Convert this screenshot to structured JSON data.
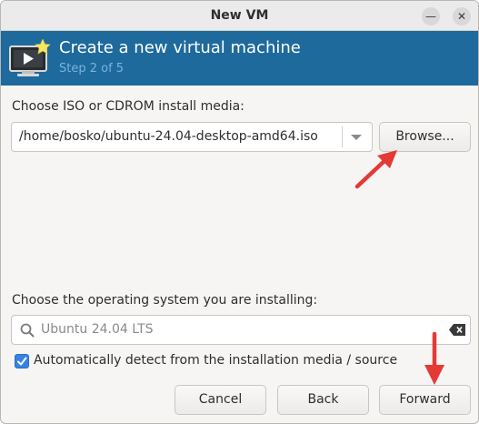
{
  "window": {
    "title": "New VM"
  },
  "header": {
    "title": "Create a new virtual machine",
    "step": "Step 2 of 5"
  },
  "media": {
    "label": "Choose ISO or CDROM install media:",
    "path": "/home/bosko/ubuntu-24.04-desktop-amd64.iso",
    "browse_label": "Browse..."
  },
  "os": {
    "label": "Choose the operating system you are installing:",
    "placeholder": "Ubuntu 24.04 LTS",
    "auto_detect_label": "Automatically detect from the installation media / source",
    "auto_detect_checked": true
  },
  "footer": {
    "cancel_label": "Cancel",
    "back_label": "Back",
    "forward_label": "Forward"
  },
  "colors": {
    "header_bg": "#1e6a9d",
    "step_text": "#79b4de",
    "accent": "#3584e4",
    "annotation_arrow": "#e53935"
  },
  "icons": [
    "vm-monitor-icon",
    "minimize-icon",
    "close-icon",
    "dropdown-arrow-icon",
    "search-icon",
    "clear-text-icon",
    "checkmark-icon",
    "annotation-arrow-icon"
  ]
}
